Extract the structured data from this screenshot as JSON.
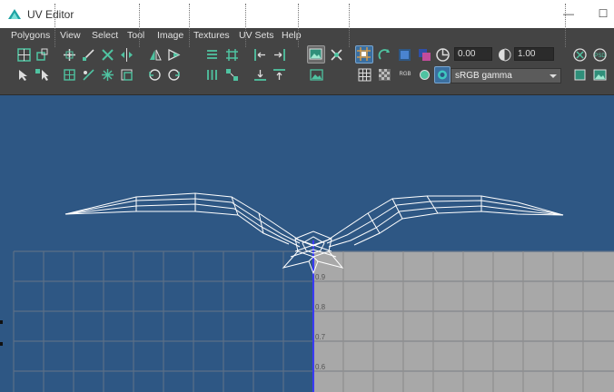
{
  "window": {
    "title": "UV Editor",
    "minimize_glyph": "—",
    "maximize_glyph": "☐"
  },
  "menu": [
    "Polygons",
    "View",
    "Select",
    "Tool",
    "Image",
    "Textures",
    "UV Sets",
    "Help"
  ],
  "toolbar": {
    "exposure_value": "0.00",
    "gamma_value": "1.00",
    "rgb_label": "RGB",
    "color_space": "sRGB gamma"
  },
  "grid_labels": [
    "0.9",
    "0.8",
    "0.7",
    "0.6"
  ],
  "colors": {
    "viewport_bg": "#2e5784",
    "uv_grid_fill": "#a8a8a8",
    "accent_teal": "#3ec8c0",
    "icon_green": "#4fc3a1"
  }
}
